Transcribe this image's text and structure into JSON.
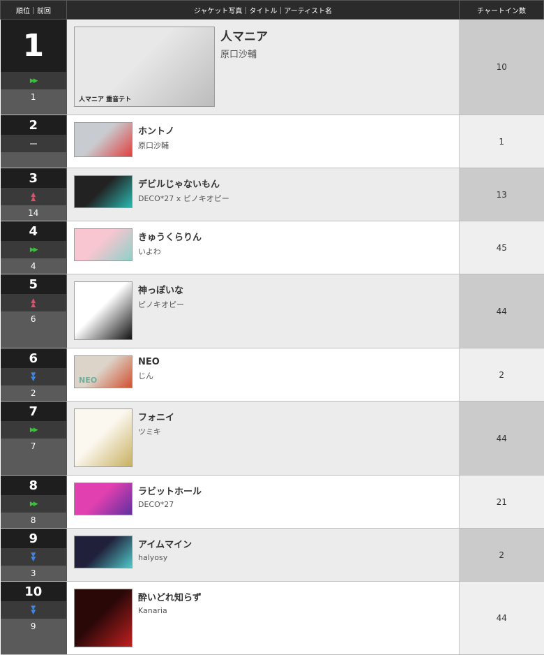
{
  "header": {
    "rank_col": "順位｜前回",
    "info_col": "ジャケット写真｜タイトル｜アーティスト名",
    "count_col": "チャートイン数"
  },
  "rows": [
    {
      "rank": "1",
      "trend": "forward",
      "prev": "1",
      "title": "人マニア",
      "artist": "原口沙輔",
      "count": "10",
      "thumb_colors": [
        "#e8e8e8",
        "#bcbcbc"
      ],
      "thumb_text": "人マニア 重音テト"
    },
    {
      "rank": "2",
      "trend": "stay",
      "prev": "",
      "title": "ホントノ",
      "artist": "原口沙輔",
      "count": "1",
      "thumb_colors": [
        "#c8ccd0",
        "#e04040"
      ]
    },
    {
      "rank": "3",
      "trend": "up",
      "prev": "14",
      "title": "デビルじゃないもん",
      "artist": "DECO*27 x ピノキオピー",
      "count": "13",
      "thumb_colors": [
        "#222",
        "#2ab8b0"
      ]
    },
    {
      "rank": "4",
      "trend": "forward",
      "prev": "4",
      "title": "きゅうくらりん",
      "artist": "いよわ",
      "count": "45",
      "thumb_colors": [
        "#f7c6d0",
        "#8fd0c8"
      ]
    },
    {
      "rank": "5",
      "trend": "up",
      "prev": "6",
      "title": "神っぽいな",
      "artist": "ピノキオピー",
      "count": "44",
      "thumb_colors": [
        "#ffffff",
        "#111111"
      ]
    },
    {
      "rank": "6",
      "trend": "down",
      "prev": "2",
      "title": "NEO",
      "artist": "じん",
      "count": "2",
      "thumb_colors": [
        "#dcd4c8",
        "#d05030"
      ],
      "thumb_text": "NEO"
    },
    {
      "rank": "7",
      "trend": "forward",
      "prev": "7",
      "title": "フォニイ",
      "artist": "ツミキ",
      "count": "44",
      "thumb_colors": [
        "#fbf8f0",
        "#c8b060"
      ]
    },
    {
      "rank": "8",
      "trend": "forward",
      "prev": "8",
      "title": "ラビットホール",
      "artist": "DECO*27",
      "count": "21",
      "thumb_colors": [
        "#e040b0",
        "#6030a0"
      ]
    },
    {
      "rank": "9",
      "trend": "down",
      "prev": "3",
      "title": "アイムマイン",
      "artist": "halyosy",
      "count": "2",
      "thumb_colors": [
        "#20203a",
        "#50c8c8"
      ]
    },
    {
      "rank": "10",
      "trend": "down",
      "prev": "9",
      "title": "酔いどれ知らず",
      "artist": "Kanaria",
      "count": "44",
      "thumb_colors": [
        "#2a0808",
        "#c02020"
      ]
    }
  ]
}
